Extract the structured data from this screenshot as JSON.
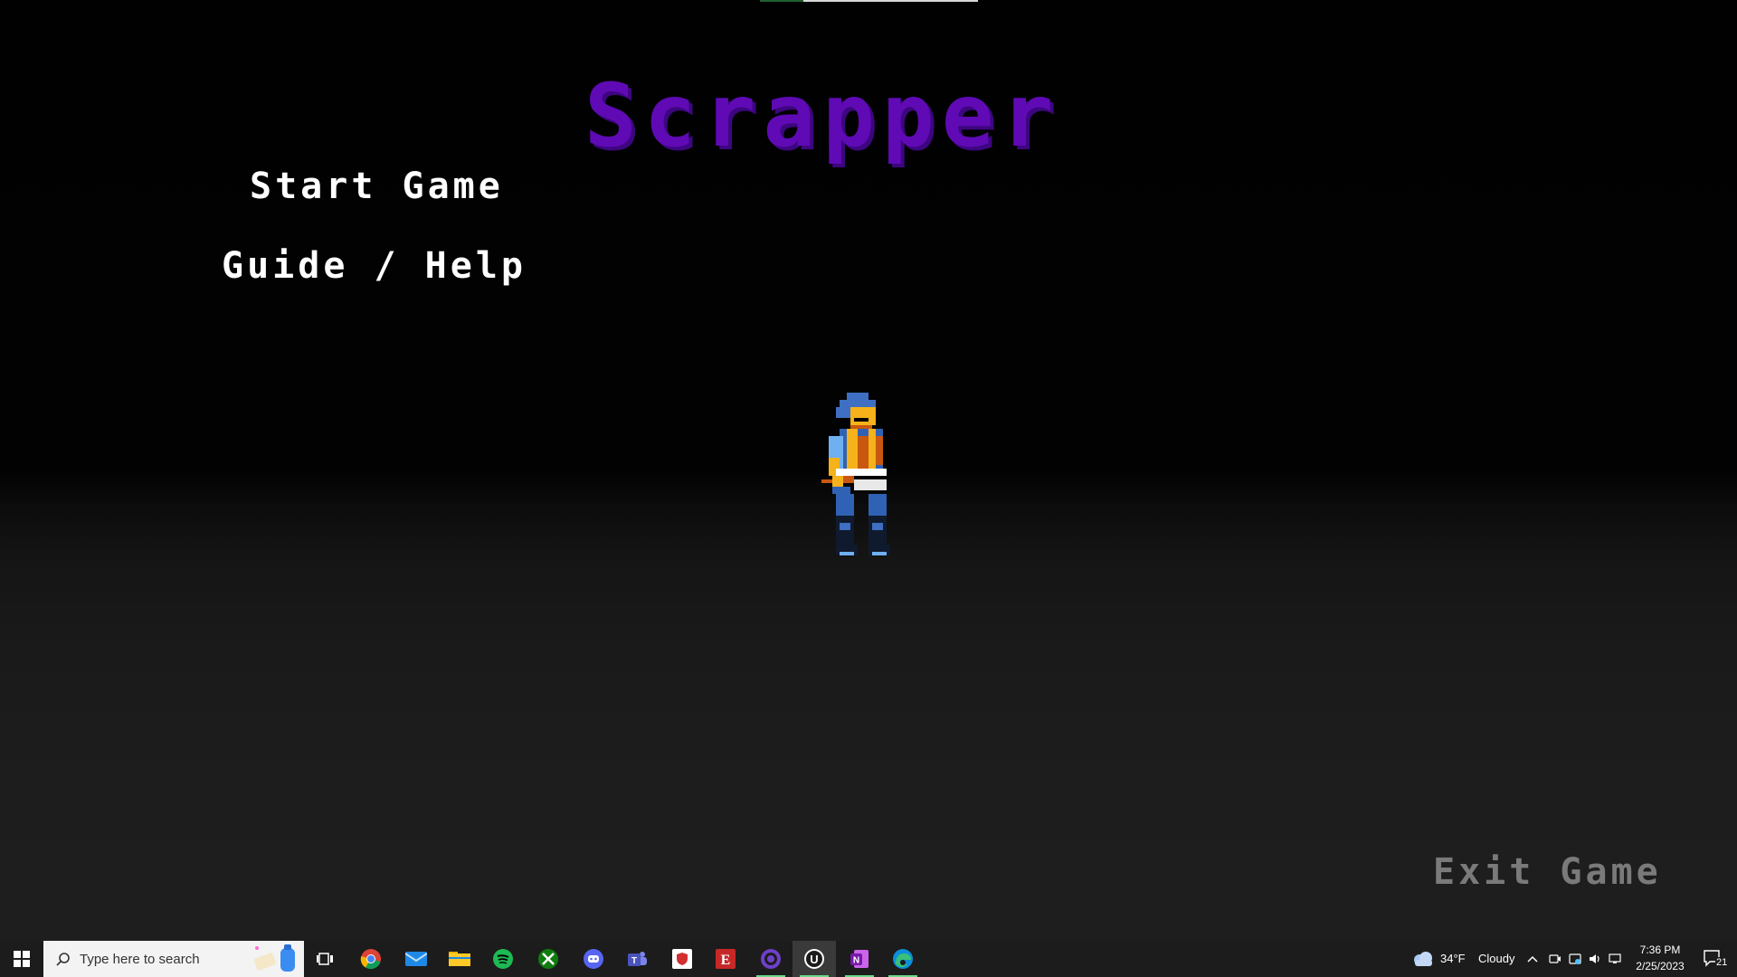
{
  "game": {
    "title": "Scrapper",
    "menu": {
      "start_label": "Start Game",
      "guide_label": "Guide / Help",
      "exit_label": "Exit Game"
    },
    "colors": {
      "title": "#5f0ab4",
      "menu_active": "#ffffff",
      "menu_dim": "#7a7a7a"
    }
  },
  "taskbar": {
    "search_placeholder": "Type here to search",
    "pinned_apps": [
      {
        "name": "chrome-icon"
      },
      {
        "name": "mail-icon"
      },
      {
        "name": "file-explorer-icon"
      },
      {
        "name": "spotify-icon"
      },
      {
        "name": "xbox-icon"
      },
      {
        "name": "discord-icon"
      },
      {
        "name": "teams-icon"
      },
      {
        "name": "security-app-icon"
      },
      {
        "name": "red-app-icon"
      },
      {
        "name": "github-desktop-icon"
      },
      {
        "name": "unreal-engine-icon"
      },
      {
        "name": "onenote-icon"
      },
      {
        "name": "edge-icon"
      }
    ],
    "weather": {
      "temperature": "34°F",
      "condition": "Cloudy"
    },
    "clock": {
      "time": "7:36 PM",
      "date": "2/25/2023"
    },
    "notifications": {
      "count": "21"
    }
  }
}
